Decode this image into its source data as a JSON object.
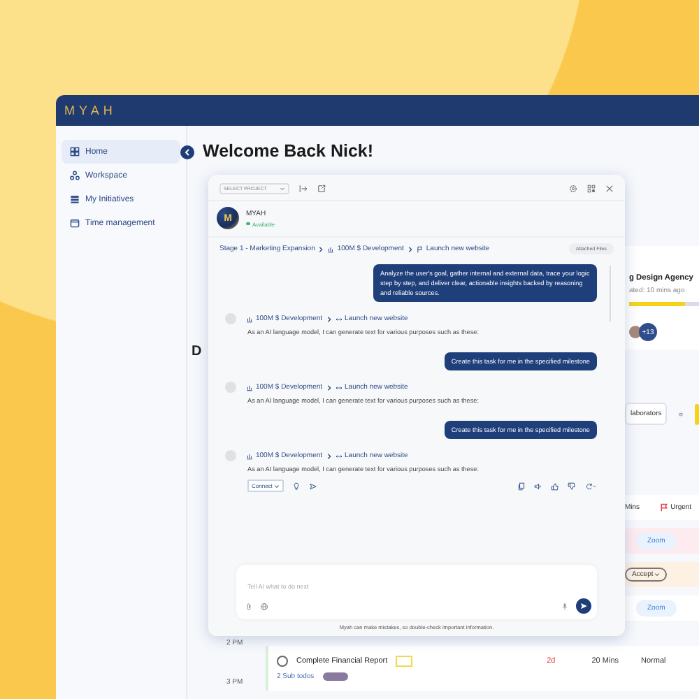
{
  "app": {
    "logo": "MYAH"
  },
  "sidebar": {
    "items": [
      {
        "label": "Home",
        "selected": true
      },
      {
        "label": "Workspace",
        "selected": false
      },
      {
        "label": "My Initiatives",
        "selected": false
      },
      {
        "label": "Time management",
        "selected": false
      }
    ]
  },
  "main": {
    "title": "Welcome Back Nick!",
    "section_heading": "D",
    "project_card": {
      "title": "g Design Agency",
      "updated": "ated: 10 mins ago",
      "level": 0.8,
      "avatars_more": "+13"
    },
    "toolbar": {
      "collaborators": "laborators"
    },
    "task_rows": [
      {
        "kind": "priority",
        "duration": "Mins",
        "priority": "Urgent",
        "color": "#ffffff"
      },
      {
        "kind": "link",
        "label": "Zoom",
        "color": "#fdebef"
      },
      {
        "kind": "accept",
        "label": "Accept",
        "color": "#fdf1e4"
      },
      {
        "kind": "link",
        "label": "Zoom",
        "color": "#ffffff"
      }
    ],
    "timeline": {
      "times": [
        "2 PM",
        "3 PM"
      ],
      "task": {
        "title": "Complete Financial Report",
        "subtodos": "2 Sub todos",
        "due": "2d",
        "duration": "20 Mins",
        "priority": "Normal",
        "done": false
      }
    }
  },
  "chat": {
    "project_select": {
      "placeholder": "SELECT PROJECT"
    },
    "assistant": {
      "name": "MYAH",
      "avatar_initial": "M",
      "status": "Available",
      "online": true
    },
    "breadcrumb": [
      "Stage 1 - Marketing Expansion",
      "100M $ Development",
      "Launch new website"
    ],
    "attached_files": "Attached Files",
    "messages": [
      {
        "kind": "user",
        "text": "Analyze the user's goal, gather internal and external data, trace your logic step by step, and deliver clear, actionable insights backed by reasoning and reliable sources."
      },
      {
        "kind": "assistant",
        "path": [
          "100M $ Development",
          "Launch new website"
        ],
        "text": "As an AI language model, I can generate text for various purposes such as these:",
        "actions": false
      },
      {
        "kind": "user",
        "text": "Create this task for me in the specified milestone"
      },
      {
        "kind": "assistant",
        "path": [
          "100M $ Development",
          "Launch new website"
        ],
        "text": "As an AI language model, I can generate text for various purposes such as these:",
        "actions": false
      },
      {
        "kind": "user",
        "text": "Create this task for me in the specified milestone"
      },
      {
        "kind": "assistant",
        "path": [
          "100M $ Development",
          "Launch new website"
        ],
        "text": "As an AI language model, I can generate text for various purposes such as these:",
        "actions": true,
        "mode": "Connect"
      }
    ],
    "input": {
      "placeholder": "Tell AI what to do next"
    },
    "disclaimer": "Myah can make mistakes, so double-check important information."
  }
}
